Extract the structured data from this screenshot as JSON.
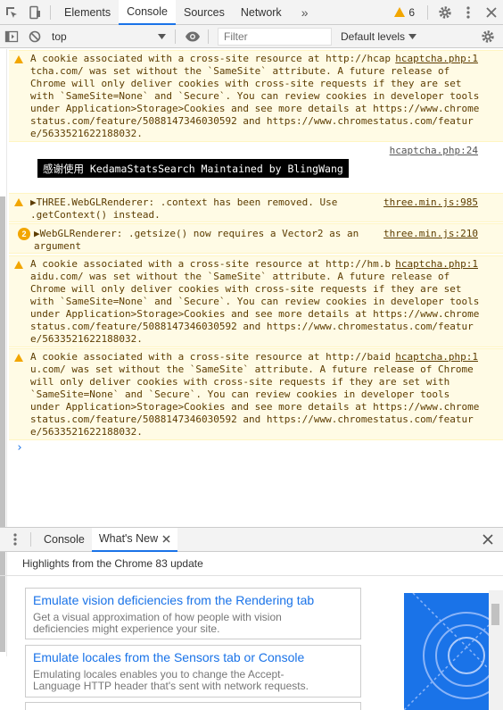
{
  "topbar": {
    "tabs": [
      "Elements",
      "Console",
      "Sources",
      "Network"
    ],
    "active_tab": "Console",
    "more_label": "»",
    "warning_count": "6"
  },
  "console_toolbar": {
    "context": "top",
    "filter_placeholder": "Filter",
    "levels": "Default levels"
  },
  "messages": {
    "m1": {
      "lines": [
        "A cookie associated with a cross-site resource at http://hcap",
        "tcha.com/ was set without the `SameSite` attribute. A future release of",
        "Chrome will only deliver cookies with cross-site requests if they are set",
        "with `SameSite=None` and `Secure`. You can review cookies in developer tools",
        "under Application>Storage>Cookies and see more details at https://www.chrome",
        "status.com/feature/5088147346030592 and https://www.chromestatus.com/featur",
        "e/5633521622188032."
      ],
      "source": "hcaptcha.php:1"
    },
    "m2": {
      "source": "hcaptcha.php:24",
      "banner": "感谢使用 KedamaStatsSearch  Maintained by BlingWang"
    },
    "m3": {
      "lines": [
        "▶THREE.WebGLRenderer: .context has been removed. Use",
        ".getContext() instead."
      ],
      "source": "three.min.js:985"
    },
    "m4": {
      "count": "2",
      "lines": [
        "▶WebGLRenderer: .getsize() now requires a Vector2 as an",
        "argument"
      ],
      "source": "three.min.js:210"
    },
    "m5": {
      "lines": [
        "A cookie associated with a cross-site resource at http://hm.b",
        "aidu.com/ was set without the `SameSite` attribute. A future release of",
        "Chrome will only deliver cookies with cross-site requests if they are set",
        "with `SameSite=None` and `Secure`. You can review cookies in developer tools",
        "under Application>Storage>Cookies and see more details at https://www.chrome",
        "status.com/feature/5088147346030592 and https://www.chromestatus.com/featur",
        "e/5633521622188032."
      ],
      "source": "hcaptcha.php:1"
    },
    "m6": {
      "lines": [
        "A cookie associated with a cross-site resource at http://baid",
        "u.com/ was set without the `SameSite` attribute. A future release of Chrome",
        "will only deliver cookies with cross-site requests if they are set with",
        "`SameSite=None` and `Secure`. You can review cookies in developer tools",
        "under Application>Storage>Cookies and see more details at https://www.chrome",
        "status.com/feature/5088147346030592 and https://www.chromestatus.com/featur",
        "e/5633521622188032."
      ],
      "source": "hcaptcha.php:1"
    },
    "prompt": "›"
  },
  "drawer": {
    "tabs": [
      "Console",
      "What's New"
    ],
    "active_tab": "What's New",
    "highlights": "Highlights from the Chrome 83 update",
    "cards": [
      {
        "title": "Emulate vision deficiencies from the Rendering tab",
        "desc1": "Get a visual approximation of how people with vision",
        "desc2": "deficiencies might experience your site."
      },
      {
        "title": "Emulate locales from the Sensors tab or Console",
        "desc1": "Emulating locales enables you to change the Accept-",
        "desc2": "Language HTTP header that's sent with network requests."
      }
    ]
  }
}
